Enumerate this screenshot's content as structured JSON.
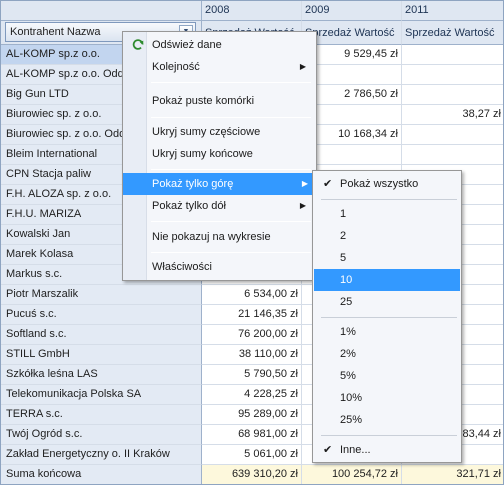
{
  "grid": {
    "row_field_label": "Kontrahent Nazwa",
    "columns": [
      {
        "year": "2008",
        "measure": "Sprzedaż Wartość"
      },
      {
        "year": "2009",
        "measure": "Sprzedaż Wartość"
      },
      {
        "year": "2011",
        "measure": "Sprzedaż Wartość"
      }
    ],
    "rows": [
      {
        "name": "AL-KOMP sp.z o.o.",
        "v2008": "",
        "v2009": "9 529,45 zł",
        "v2011": ""
      },
      {
        "name": "AL-KOMP sp.z o.o. Oddz",
        "v2008": "",
        "v2009": "",
        "v2011": ""
      },
      {
        "name": "Big Gun LTD",
        "v2008": "",
        "v2009": "2 786,50 zł",
        "v2011": ""
      },
      {
        "name": "Biurowiec sp. z o.o.",
        "v2008": "",
        "v2009": "",
        "v2011": "38,27 zł"
      },
      {
        "name": "Biurowiec sp. z o.o. Odd",
        "v2008": "",
        "v2009": "10 168,34 zł",
        "v2011": ""
      },
      {
        "name": "Bleim International",
        "v2008": "",
        "v2009": "",
        "v2011": ""
      },
      {
        "name": "CPN Stacja paliw",
        "v2008": "",
        "v2009": "",
        "v2011": ""
      },
      {
        "name": "F.H. ALOZA sp. z o.o.",
        "v2008": "",
        "v2009": "",
        "v2011": ""
      },
      {
        "name": "F.H.U. MARIZA",
        "v2008": "",
        "v2009": "",
        "v2011": ""
      },
      {
        "name": "Kowalski Jan",
        "v2008": "",
        "v2009": "",
        "v2011": ""
      },
      {
        "name": "Marek Kolasa",
        "v2008": "",
        "v2009": "",
        "v2011": ""
      },
      {
        "name": "Markus s.c.",
        "v2008": "",
        "v2009": "",
        "v2011": ""
      },
      {
        "name": "Piotr Marszalik",
        "v2008": "6 534,00 zł",
        "v2009": "",
        "v2011": ""
      },
      {
        "name": "Pucuś s.c.",
        "v2008": "21 146,35 zł",
        "v2009": "",
        "v2011": ""
      },
      {
        "name": "Softland s.c.",
        "v2008": "76 200,00 zł",
        "v2009": "",
        "v2011": ""
      },
      {
        "name": "STILL GmbH",
        "v2008": "38 110,00 zł",
        "v2009": "",
        "v2011": ""
      },
      {
        "name": "Szkółka leśna LAS",
        "v2008": "5 790,50 zł",
        "v2009": "",
        "v2011": ""
      },
      {
        "name": "Telekomunikacja Polska SA",
        "v2008": "4 228,25 zł",
        "v2009": "",
        "v2011": ""
      },
      {
        "name": "TERRA s.c.",
        "v2008": "95 289,00 zł",
        "v2009": "",
        "v2011": ""
      },
      {
        "name": "Twój Ogród s.c.",
        "v2008": "68 981,00 zł",
        "v2009": "",
        "v2011": "83,44 zł"
      },
      {
        "name": "Zakład Energetyczny o. II Kraków",
        "v2008": "5 061,00 zł",
        "v2009": "",
        "v2011": ""
      }
    ],
    "total": {
      "name": "Suma końcowa",
      "v2008": "639 310,20 zł",
      "v2009": "100 254,72 zł",
      "v2011": "321,71 zł"
    }
  },
  "context_menu": {
    "items": [
      {
        "label": "Odśwież dane",
        "icon": "refresh-icon"
      },
      {
        "label": "Kolejność",
        "submenu": true
      },
      {
        "label": "Pokaż puste komórki"
      },
      {
        "label": "Ukryj sumy częściowe"
      },
      {
        "label": "Ukryj sumy końcowe"
      },
      {
        "label": "Pokaż tylko górę",
        "submenu": true,
        "highlighted": true
      },
      {
        "label": "Pokaż tylko dół",
        "submenu": true
      },
      {
        "label": "Nie pokazuj na wykresie"
      },
      {
        "label": "Właściwości"
      }
    ],
    "arrow_glyph": "▶"
  },
  "submenu": {
    "items": [
      {
        "label": "Pokaż wszystko",
        "checked": true
      },
      {
        "label": "1"
      },
      {
        "label": "2"
      },
      {
        "label": "5"
      },
      {
        "label": "10",
        "highlighted": true
      },
      {
        "label": "25"
      },
      {
        "label": "1%"
      },
      {
        "label": "2%"
      },
      {
        "label": "5%"
      },
      {
        "label": "10%"
      },
      {
        "label": "25%"
      },
      {
        "label": "Inne...",
        "checked": true
      }
    ],
    "check_glyph": "✔"
  },
  "colors": {
    "highlight": "#3399ff",
    "row_header_bg": "#e3eaf4",
    "total_bg": "#fdf8dc"
  }
}
